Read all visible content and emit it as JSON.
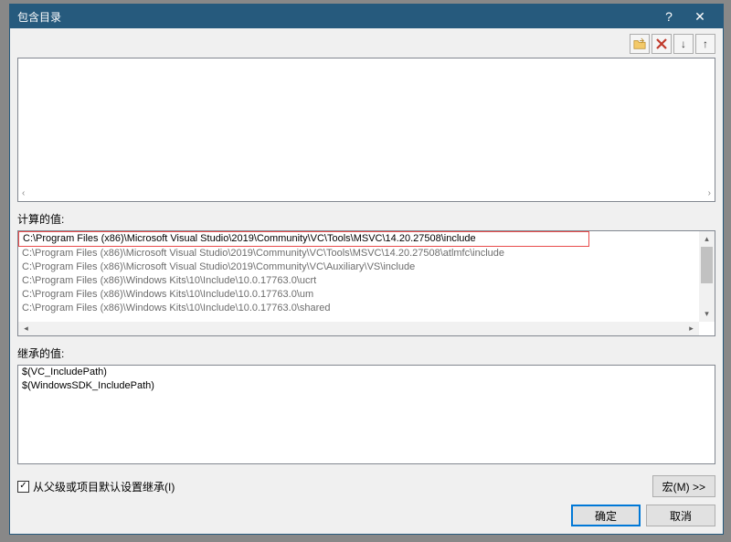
{
  "dialog": {
    "title": "包含目录"
  },
  "titlebar": {
    "help_icon": "?",
    "close_icon": "✕"
  },
  "toolbar": {
    "add_tooltip": "new-line",
    "delete_tooltip": "delete",
    "down_tooltip": "move-down",
    "up_tooltip": "move-up"
  },
  "labels": {
    "computed": "计算的值:",
    "inherited": "继承的值:",
    "inherit_checkbox": "从父级或项目默认设置继承(I)",
    "macros_button": "宏(M) >>",
    "ok": "确定",
    "cancel": "取消"
  },
  "computed_values": [
    "C:\\Program Files (x86)\\Microsoft Visual Studio\\2019\\Community\\VC\\Tools\\MSVC\\14.20.27508\\include",
    "C:\\Program Files (x86)\\Microsoft Visual Studio\\2019\\Community\\VC\\Tools\\MSVC\\14.20.27508\\atlmfc\\include",
    "C:\\Program Files (x86)\\Microsoft Visual Studio\\2019\\Community\\VC\\Auxiliary\\VS\\include",
    "C:\\Program Files (x86)\\Windows Kits\\10\\Include\\10.0.17763.0\\ucrt",
    "C:\\Program Files (x86)\\Windows Kits\\10\\Include\\10.0.17763.0\\um",
    "C:\\Program Files (x86)\\Windows Kits\\10\\Include\\10.0.17763.0\\shared"
  ],
  "inherited_values": [
    "$(VC_IncludePath)",
    "$(WindowsSDK_IncludePath)"
  ],
  "inherit_checked": true
}
